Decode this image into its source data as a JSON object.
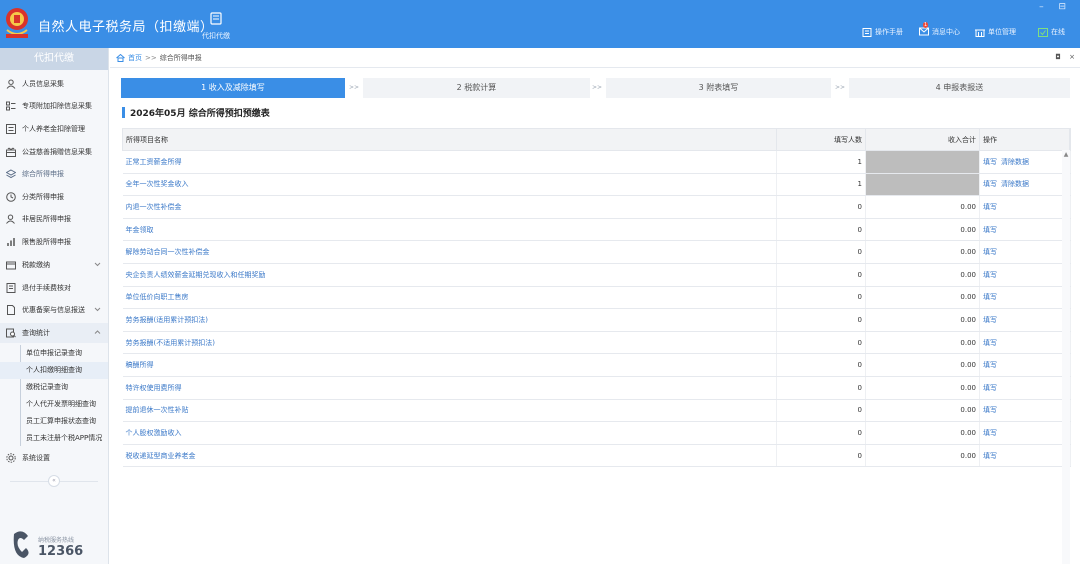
{
  "app": {
    "title": "自然人电子税务局（扣缴端）",
    "top_tool_label": "代扣代缴",
    "window_controls": "–  ⊟",
    "header_links": [
      {
        "label": "操作手册",
        "icon": "manual-icon"
      },
      {
        "label": "消息中心",
        "icon": "mail-icon",
        "badge": "1"
      },
      {
        "label": "单位管理",
        "icon": "building-icon"
      },
      {
        "label": "在线",
        "icon": "online-check-icon"
      }
    ]
  },
  "sidebar": {
    "header": "代扣代缴",
    "items": [
      {
        "label": "人员信息采集",
        "icon": "person-icon"
      },
      {
        "label": "专项附加扣除信息采集",
        "icon": "list-icon"
      },
      {
        "label": "个人养老金扣除管理",
        "icon": "pension-icon"
      },
      {
        "label": "公益慈善捐赠信息采集",
        "icon": "donation-icon"
      },
      {
        "label": "综合所得申报",
        "icon": "layers-icon"
      },
      {
        "label": "分类所得申报",
        "icon": "clock-icon"
      },
      {
        "label": "非居民所得申报",
        "icon": "user-outline-icon"
      },
      {
        "label": "限售股所得申报",
        "icon": "bar-chart-icon"
      },
      {
        "label": "税款缴纳",
        "icon": "wallet-icon"
      },
      {
        "label": "退付手续费核对",
        "icon": "receipt-icon"
      },
      {
        "label": "优惠备案与信息报送",
        "icon": "document-icon"
      },
      {
        "label": "查询统计",
        "icon": "query-icon"
      },
      {
        "label": "系统设置",
        "icon": "gear-icon"
      }
    ],
    "sub_items": [
      "单位申报记录查询",
      "个人扣缴明细查询",
      "缴税记录查询",
      "个人代开发票明细查询",
      "员工汇算申报状态查询",
      "员工未注册个税APP情况"
    ],
    "collapse_glyph": "«",
    "hotline_label": "纳税服务热线",
    "hotline_number": "12366"
  },
  "breadcrumb": {
    "home": "首页",
    "sep": ">>",
    "current": "综合所得申报",
    "controls": "◘ ×"
  },
  "steps": [
    {
      "label": "1 收入及减除填写",
      "active": true
    },
    {
      "label": "2 税款计算",
      "active": false
    },
    {
      "label": "3 附表填写",
      "active": false
    },
    {
      "label": "4 申报表报送",
      "active": false
    }
  ],
  "step_arrow": ">>",
  "form_title": "2026年05月  综合所得预扣预缴表",
  "table": {
    "headers": [
      "所得项目名称",
      "填写人数",
      "收入合计",
      "操作"
    ],
    "op_fill": "填写",
    "op_clear": "清除数据",
    "rows": [
      {
        "name": "正常工资薪金所得",
        "count": "1",
        "income": "",
        "masked": true,
        "ops": [
          "填写",
          "清除数据"
        ]
      },
      {
        "name": "全年一次性奖金收入",
        "count": "1",
        "income": "",
        "masked": true,
        "ops": [
          "填写",
          "清除数据"
        ]
      },
      {
        "name": "内退一次性补偿金",
        "count": "0",
        "income": "0.00",
        "masked": false,
        "ops": [
          "填写"
        ]
      },
      {
        "name": "年金领取",
        "count": "0",
        "income": "0.00",
        "masked": false,
        "ops": [
          "填写"
        ]
      },
      {
        "name": "解除劳动合同一次性补偿金",
        "count": "0",
        "income": "0.00",
        "masked": false,
        "ops": [
          "填写"
        ]
      },
      {
        "name": "央企负责人绩效薪金延期兑现收入和任期奖励",
        "count": "0",
        "income": "0.00",
        "masked": false,
        "ops": [
          "填写"
        ]
      },
      {
        "name": "单位低价向职工售房",
        "count": "0",
        "income": "0.00",
        "masked": false,
        "ops": [
          "填写"
        ]
      },
      {
        "name": "劳务报酬(适用累计预扣法)",
        "count": "0",
        "income": "0.00",
        "masked": false,
        "ops": [
          "填写"
        ]
      },
      {
        "name": "劳务报酬(不适用累计预扣法)",
        "count": "0",
        "income": "0.00",
        "masked": false,
        "ops": [
          "填写"
        ]
      },
      {
        "name": "稿酬所得",
        "count": "0",
        "income": "0.00",
        "masked": false,
        "ops": [
          "填写"
        ]
      },
      {
        "name": "特许权使用费所得",
        "count": "0",
        "income": "0.00",
        "masked": false,
        "ops": [
          "填写"
        ]
      },
      {
        "name": "提前退休一次性补贴",
        "count": "0",
        "income": "0.00",
        "masked": false,
        "ops": [
          "填写"
        ]
      },
      {
        "name": "个人股权激励收入",
        "count": "0",
        "income": "0.00",
        "masked": false,
        "ops": [
          "填写"
        ]
      },
      {
        "name": "税收递延型商业养老金",
        "count": "0",
        "income": "0.00",
        "masked": false,
        "ops": [
          "填写"
        ]
      }
    ]
  },
  "colors": {
    "accent": "#3a8ee6",
    "link": "#3a78c8",
    "badge": "#f04a3a"
  }
}
